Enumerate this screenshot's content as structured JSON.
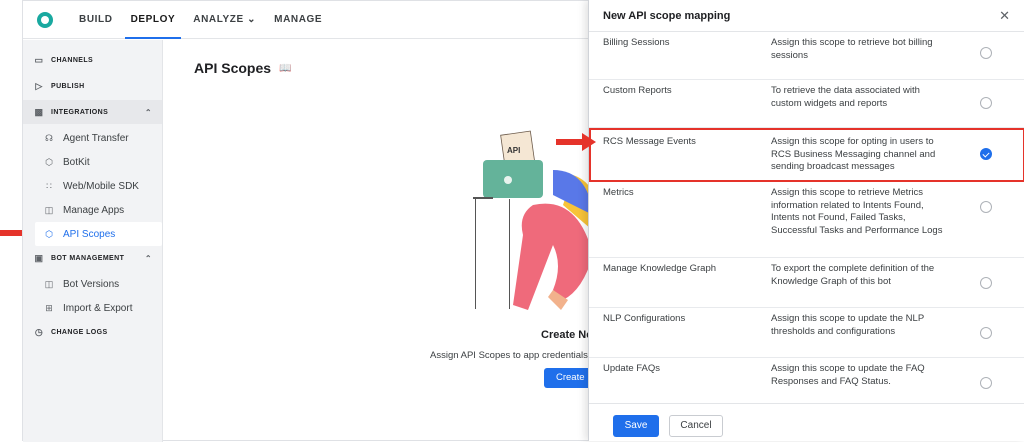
{
  "nav": {
    "tabs": [
      {
        "label": "BUILD"
      },
      {
        "label": "DEPLOY"
      },
      {
        "label": "ANALYZE ⌄"
      },
      {
        "label": "MANAGE"
      }
    ]
  },
  "sidebar": {
    "channels": "CHANNELS",
    "publish": "PUBLISH",
    "integrations": "INTEGRATIONS",
    "integration_items": [
      {
        "label": "Agent Transfer",
        "icon": "headset-icon"
      },
      {
        "label": "BotKit",
        "icon": "cube-icon"
      },
      {
        "label": "Web/Mobile SDK",
        "icon": "grid-icon"
      },
      {
        "label": "Manage Apps",
        "icon": "app-icon"
      },
      {
        "label": "API Scopes",
        "icon": "scope-icon"
      }
    ],
    "bot_management": "BOT MANAGEMENT",
    "bot_items": [
      {
        "label": "Bot Versions",
        "icon": "version-icon"
      },
      {
        "label": "Import & Export",
        "icon": "import-export-icon"
      }
    ],
    "change_logs": "CHANGE LOGS"
  },
  "main": {
    "title": "API Scopes",
    "illustration_tag": "API",
    "empty_title": "Create Ne",
    "empty_sub": "Assign API Scopes to app credentials",
    "create_label": "Create"
  },
  "modal": {
    "title": "New API scope mapping",
    "rows": [
      {
        "name": "Billing Sessions",
        "desc": "Assign this scope to retrieve bot billing sessions",
        "checked": false
      },
      {
        "name": "Custom Reports",
        "desc": "To retrieve the data associated with custom widgets and reports",
        "checked": false
      },
      {
        "name": "RCS Message Events",
        "desc": "Assign this scope for opting in users to RCS Business Messaging channel and sending broadcast messages",
        "checked": true
      },
      {
        "name": "Metrics",
        "desc": "Assign this scope to retrieve Metrics information related to Intents Found, Intents not Found, Failed Tasks, Successful Tasks and Performance Logs",
        "checked": false
      },
      {
        "name": "Manage Knowledge Graph",
        "desc": "To export the complete definition of the Knowledge Graph of this bot",
        "checked": false
      },
      {
        "name": "NLP Configurations",
        "desc": "Assign this scope to update the NLP thresholds and configurations",
        "checked": false
      },
      {
        "name": "Update FAQs",
        "desc": "Assign this scope to update the FAQ Responses and FAQ Status.",
        "checked": false
      }
    ],
    "save_label": "Save",
    "cancel_label": "Cancel"
  },
  "colors": {
    "accent": "#1f6feb",
    "highlight": "#e5332a"
  }
}
